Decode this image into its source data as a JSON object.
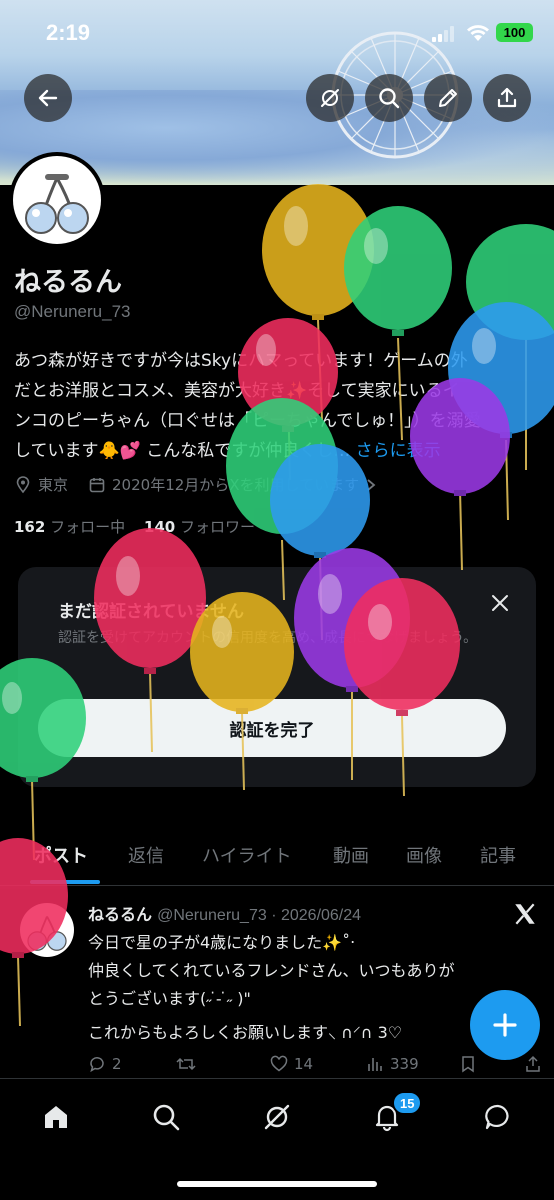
{
  "status_bar": {
    "time": "2:19",
    "battery": "100"
  },
  "profile": {
    "name": "ねるるん",
    "handle": "@Neruneru_73",
    "bio_line1": "あつ森が好きですが今はSkyにハマっています！ゲームの外",
    "bio_line2": "だとお洋服とコスメ、美容が大好き✨そして実家にいるイ",
    "bio_line3": "ンコのピーちゃん（口ぐせは「ピーちゃんでしゅ！」）を溺愛",
    "bio_line4": "しています🐥💕 こんな私ですが仲良くし…",
    "bio_more": "さらに表示",
    "location": "東京",
    "joined": "2020年12月からXを利用しています",
    "following_count": "162",
    "following_label": "フォロー中",
    "followers_count": "140",
    "followers_label": "フォロワー"
  },
  "verify_card": {
    "title": "まだ認証されていません",
    "description": "認証を受けてアカウントの信用度を高め、成長につなげましょう。",
    "button": "認証を完了"
  },
  "tabs": [
    "ポスト",
    "返信",
    "ハイライト",
    "動画",
    "画像",
    "記事"
  ],
  "post": {
    "name": "ねるるん",
    "handle_date": "@Neruneru_73 · 2026/06/24",
    "line1": "今日で星の子が4歳になりました✨˚‧",
    "line2": "仲良くしてくれているフレンドさん、いつもありが",
    "line3": "とうございます(˶ ̇ ̵ ̇˶ )\"",
    "line4": "これからもよろしくお願いします⸜ ∩⸍∩ 3♡",
    "replies": "2",
    "reposts": "",
    "likes": "14",
    "views": "339"
  },
  "bottom_nav": {
    "notifications_badge": "15"
  },
  "icons": [
    "back-icon",
    "grok-icon",
    "search-icon",
    "pencil-icon",
    "share-icon",
    "location-icon",
    "calendar-icon",
    "close-icon",
    "x-logo-icon",
    "plus-icon",
    "home-icon",
    "bell-icon",
    "messages-icon"
  ],
  "colors": {
    "accent": "#1d9bf0",
    "background": "#000000",
    "text": "#e7e9ea",
    "muted": "#71767b"
  }
}
